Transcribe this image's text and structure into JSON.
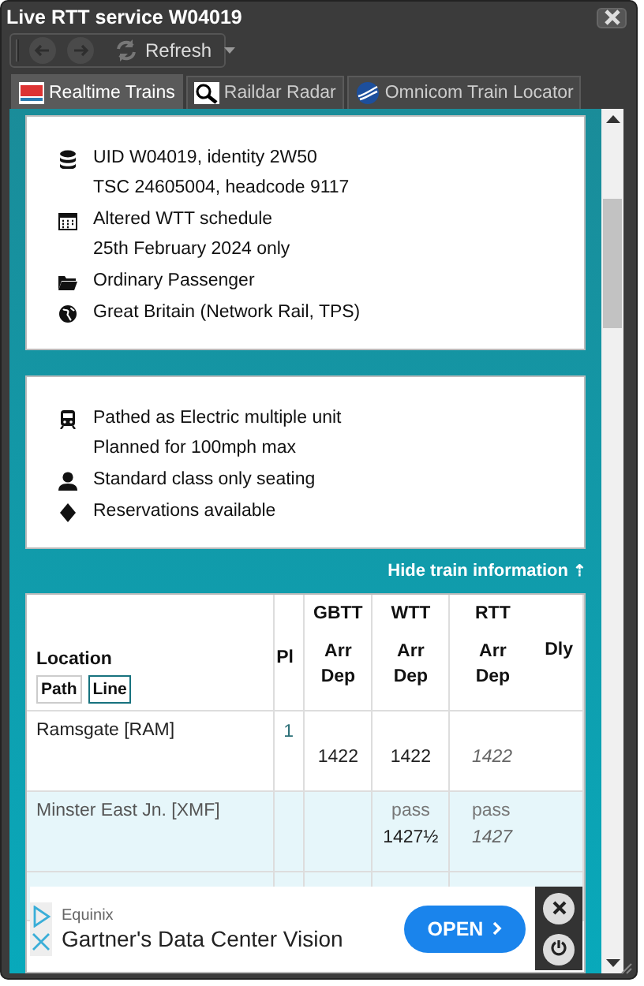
{
  "window": {
    "title": "Live RTT service W04019"
  },
  "toolbar": {
    "back": {
      "disabled": true
    },
    "forward": {
      "disabled": true
    },
    "refresh": {
      "label": "Refresh"
    }
  },
  "tabs": [
    {
      "label": "Realtime Trains",
      "kind": "rtt",
      "selected": true
    },
    {
      "label": "Raildar Radar",
      "kind": "radar",
      "selected": false
    },
    {
      "label": "Omnicom Train Locator",
      "kind": "omnicom",
      "selected": false
    }
  ],
  "info_cards": [
    {
      "items": [
        {
          "kind": "database",
          "lines": [
            "UID W04019, identity 2W50",
            "TSC 24605004, headcode 9117"
          ]
        },
        {
          "kind": "calendar",
          "lines": [
            "Altered WTT schedule",
            "25th February 2024 only"
          ]
        },
        {
          "kind": "folder",
          "lines": [
            "Ordinary Passenger"
          ]
        },
        {
          "kind": "globe",
          "lines": [
            "Great Britain (Network Rail, TPS)"
          ]
        }
      ]
    },
    {
      "items": [
        {
          "kind": "train",
          "lines": [
            "Pathed as Electric multiple unit",
            "Planned for 100mph max"
          ]
        },
        {
          "kind": "person",
          "lines": [
            "Standard class only seating"
          ]
        },
        {
          "kind": "diamond",
          "lines": [
            "Reservations available"
          ]
        }
      ]
    }
  ],
  "hide_link": {
    "label": "Hide train information",
    "icon": "⇡"
  },
  "table": {
    "location_heading": "Location",
    "toggles": [
      {
        "label": "Path",
        "selected": false
      },
      {
        "label": "Line",
        "selected": true
      }
    ],
    "platform_heading": "Pl",
    "groups": [
      {
        "title": "GBTT",
        "arr": "Arr",
        "dep": "Dep"
      },
      {
        "title": "WTT",
        "arr": "Arr",
        "dep": "Dep"
      },
      {
        "title": "RTT",
        "arr": "Arr",
        "dep": "Dep"
      }
    ],
    "delay_heading": "Dly",
    "rows": [
      {
        "location": "Ramsgate [RAM]",
        "platform": "1",
        "pass": false,
        "gbtt_dep": "1422",
        "wtt_dep": "1422",
        "rtt_dep": "1422"
      },
      {
        "location": "Minster East Jn. [XMF]",
        "pass": true,
        "wtt_arr": "pass",
        "wtt_dep": "1427½",
        "rtt_arr": "pass",
        "rtt_dep": "1427"
      }
    ]
  },
  "ad": {
    "sponsor": "Equinix",
    "headline": "Gartner's Data Center Vision",
    "button": "OPEN"
  }
}
